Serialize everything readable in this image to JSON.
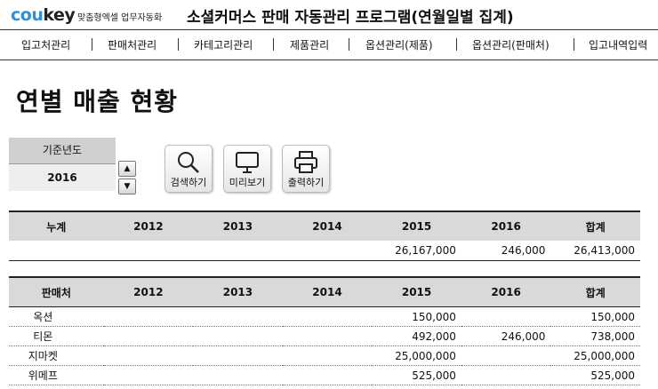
{
  "brand": {
    "logo_part1": "cou",
    "logo_part2": "key",
    "tagline": "맞춤형엑셀 업무자동화"
  },
  "app_title": "소셜커머스 판매 자동관리 프로그램(연월일별 집계)",
  "nav": [
    "입고처관리",
    "판매처관리",
    "카테고리관리",
    "제품관리",
    "옵션관리(제품)",
    "옵션관리(판매처)",
    "입고내역입력"
  ],
  "page_title": "연별 매출 현황",
  "filter": {
    "label": "기준년도",
    "value": "2016"
  },
  "buttons": {
    "search": "검색하기",
    "preview": "미리보기",
    "print": "출력하기"
  },
  "summary_table": {
    "headers": [
      "누계",
      "2012",
      "2013",
      "2014",
      "2015",
      "2016",
      "합계"
    ],
    "rows": [
      [
        "",
        "",
        "",
        "",
        "26,167,000",
        "246,000",
        "26,413,000"
      ]
    ]
  },
  "vendor_table": {
    "headers": [
      "판매처",
      "2012",
      "2013",
      "2014",
      "2015",
      "2016",
      "합계"
    ],
    "rows": [
      [
        "옥션",
        "",
        "",
        "",
        "150,000",
        "",
        "150,000"
      ],
      [
        "티몬",
        "",
        "",
        "",
        "492,000",
        "246,000",
        "738,000"
      ],
      [
        "지마켓",
        "",
        "",
        "",
        "25,000,000",
        "",
        "25,000,000"
      ],
      [
        "위메프",
        "",
        "",
        "",
        "525,000",
        "",
        "525,000"
      ]
    ]
  },
  "icons": {
    "search": "magnifier-icon",
    "preview": "monitor-icon",
    "print": "printer-icon",
    "up": "arrow-up-icon",
    "down": "arrow-down-icon"
  },
  "colors": {
    "logo_blue": "#2f8fd8",
    "header_gray": "#d9d9d9",
    "label_gray": "#cfcfcf"
  }
}
